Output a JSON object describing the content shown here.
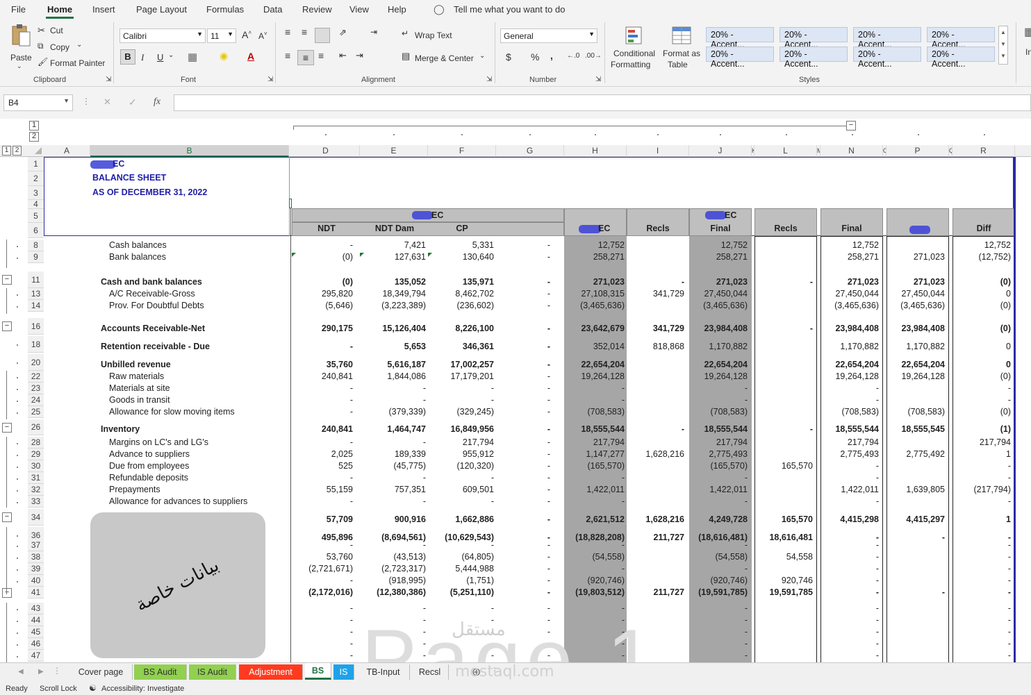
{
  "menu": [
    "File",
    "Home",
    "Insert",
    "Page Layout",
    "Formulas",
    "Data",
    "Review",
    "View",
    "Help"
  ],
  "menu_active": "Home",
  "tell_me": "Tell me what you want to do",
  "clipboard": {
    "paste": "Paste",
    "cut": "Cut",
    "copy": "Copy",
    "format_painter": "Format Painter",
    "label": "Clipboard"
  },
  "font": {
    "name": "Calibri",
    "size": "11",
    "bold": "B",
    "italic": "I",
    "underline": "U",
    "label": "Font"
  },
  "alignment": {
    "wrap": "Wrap Text",
    "merge": "Merge & Center",
    "label": "Alignment"
  },
  "number": {
    "format": "General",
    "currency": "$",
    "percent": "%",
    "comma": ",",
    "label": "Number"
  },
  "styles": {
    "conditional": "Conditional",
    "conditional2": "Formatting",
    "format_as": "Format as",
    "format_as2": "Table",
    "cells": [
      "20% - Accent...",
      "20% - Accent...",
      "20% - Accent...",
      "20% - Accent...",
      "20% - Accent...",
      "20% - Accent...",
      "20% - Accent...",
      "20% - Accent..."
    ],
    "label": "Styles",
    "insert_label": "In"
  },
  "formula_bar": {
    "name_box": "B4",
    "fx": "fx",
    "cancel": "✕",
    "enter": "✓",
    "value": ""
  },
  "outline_levels": [
    "1",
    "2"
  ],
  "columns": [
    "A",
    "B",
    "D",
    "E",
    "F",
    "G",
    "H",
    "I",
    "J",
    "K",
    "L",
    "M",
    "N",
    "O",
    "P",
    "Q",
    "R"
  ],
  "rows": [
    "1",
    "2",
    "3",
    "4",
    "5",
    "6",
    "8",
    "9",
    "11",
    "13",
    "14",
    "16",
    "18",
    "20",
    "22",
    "23",
    "24",
    "25",
    "26",
    "28",
    "29",
    "30",
    "31",
    "32",
    "33",
    "34",
    "36",
    "37",
    "38",
    "39",
    "40",
    "41",
    "43",
    "44",
    "45",
    "46",
    "47"
  ],
  "titles": {
    "company": "EC",
    "report": "BALANCE SHEET",
    "as_of": "AS OF DECEMBER 31, 2022"
  },
  "headers": {
    "group_ec": "EC",
    "ndt": "NDT",
    "ndt_dam": "NDT Dam",
    "cp": "CP",
    "h": "EC",
    "recls": "Recls",
    "j_top": "EC",
    "j_bottom": "Final",
    "l": "Recls",
    "n": "Final",
    "p": "",
    "diff": "Diff"
  },
  "lines": [
    {
      "label": "Cash balances",
      "bold": false,
      "indent": 2,
      "d": "-",
      "e": "7,421",
      "f": "5,331",
      "g": "-",
      "h": "12,752",
      "i": "",
      "j": "12,752",
      "l": "",
      "n": "12,752",
      "p": "",
      "r": "12,752"
    },
    {
      "label": "Bank balances",
      "bold": false,
      "indent": 2,
      "d": "(0)",
      "e": "127,631",
      "f": "130,640",
      "g": "-",
      "h": "258,271",
      "i": "",
      "j": "258,271",
      "l": "",
      "n": "258,271",
      "p": "271,023",
      "r": "(12,752)"
    },
    {
      "label": "Cash and bank balances",
      "bold": true,
      "indent": 1,
      "d": "(0)",
      "e": "135,052",
      "f": "135,971",
      "g": "-",
      "h": "271,023",
      "i": "-",
      "j": "271,023",
      "l": "-",
      "n": "271,023",
      "p": "271,023",
      "r": "(0)"
    },
    {
      "label": "A/C Receivable-Gross",
      "bold": false,
      "indent": 2,
      "d": "295,820",
      "e": "18,349,794",
      "f": "8,462,702",
      "g": "-",
      "h": "27,108,315",
      "i": "341,729",
      "j": "27,450,044",
      "l": "",
      "n": "27,450,044",
      "p": "27,450,044",
      "r": "0"
    },
    {
      "label": "Prov. For Doubtful Debts",
      "bold": false,
      "indent": 2,
      "d": "(5,646)",
      "e": "(3,223,389)",
      "f": "(236,602)",
      "g": "-",
      "h": "(3,465,636)",
      "i": "",
      "j": "(3,465,636)",
      "l": "",
      "n": "(3,465,636)",
      "p": "(3,465,636)",
      "r": "(0)"
    },
    {
      "label": "Accounts Receivable-Net",
      "bold": true,
      "indent": 1,
      "d": "290,175",
      "e": "15,126,404",
      "f": "8,226,100",
      "g": "-",
      "h": "23,642,679",
      "i": "341,729",
      "j": "23,984,408",
      "l": "-",
      "n": "23,984,408",
      "p": "23,984,408",
      "r": "(0)"
    },
    {
      "label": "Retention receivable - Due",
      "bold": true,
      "indent": 1,
      "d": "-",
      "e": "5,653",
      "f": "346,361",
      "g": "-",
      "h": "352,014",
      "i": "818,868",
      "j": "1,170,882",
      "l": "",
      "n": "1,170,882",
      "p": "1,170,882",
      "r": "0",
      "nb": true
    },
    {
      "label": "Unbilled revenue",
      "bold": true,
      "indent": 1,
      "d": "35,760",
      "e": "5,616,187",
      "f": "17,002,257",
      "g": "-",
      "h": "22,654,204",
      "i": "",
      "j": "22,654,204",
      "l": "",
      "n": "22,654,204",
      "p": "22,654,204",
      "r": "0"
    },
    {
      "label": "Raw materials",
      "bold": false,
      "indent": 2,
      "d": "240,841",
      "e": "1,844,086",
      "f": "17,179,201",
      "g": "-",
      "h": "19,264,128",
      "i": "",
      "j": "19,264,128",
      "l": "",
      "n": "19,264,128",
      "p": "19,264,128",
      "r": "(0)"
    },
    {
      "label": "Materials at site",
      "bold": false,
      "indent": 2,
      "d": "-",
      "e": "-",
      "f": "-",
      "g": "-",
      "h": "-",
      "i": "",
      "j": "-",
      "l": "",
      "n": "-",
      "p": "",
      "r": "-"
    },
    {
      "label": "Goods in transit",
      "bold": false,
      "indent": 2,
      "d": "-",
      "e": "-",
      "f": "-",
      "g": "-",
      "h": "-",
      "i": "",
      "j": "-",
      "l": "",
      "n": "-",
      "p": "",
      "r": "-"
    },
    {
      "label": "Allowance for slow moving items",
      "bold": false,
      "indent": 2,
      "d": "-",
      "e": "(379,339)",
      "f": "(329,245)",
      "g": "-",
      "h": "(708,583)",
      "i": "",
      "j": "(708,583)",
      "l": "",
      "n": "(708,583)",
      "p": "(708,583)",
      "r": "(0)"
    },
    {
      "label": "Inventory",
      "bold": true,
      "indent": 1,
      "d": "240,841",
      "e": "1,464,747",
      "f": "16,849,956",
      "g": "-",
      "h": "18,555,544",
      "i": "-",
      "j": "18,555,544",
      "l": "-",
      "n": "18,555,544",
      "p": "18,555,545",
      "r": "(1)"
    },
    {
      "label": "Margins on LC's and LG's",
      "bold": false,
      "indent": 2,
      "d": "-",
      "e": "-",
      "f": "217,794",
      "g": "-",
      "h": "217,794",
      "i": "",
      "j": "217,794",
      "l": "",
      "n": "217,794",
      "p": "",
      "r": "217,794"
    },
    {
      "label": "Advance to suppliers",
      "bold": false,
      "indent": 2,
      "d": "2,025",
      "e": "189,339",
      "f": "955,912",
      "g": "-",
      "h": "1,147,277",
      "i": "1,628,216",
      "j": "2,775,493",
      "l": "",
      "n": "2,775,493",
      "p": "2,775,492",
      "r": "1"
    },
    {
      "label": "Due from employees",
      "bold": false,
      "indent": 2,
      "d": "525",
      "e": "(45,775)",
      "f": "(120,320)",
      "g": "-",
      "h": "(165,570)",
      "i": "",
      "j": "(165,570)",
      "l": "165,570",
      "n": "-",
      "p": "",
      "r": "-"
    },
    {
      "label": "Refundable deposits",
      "bold": false,
      "indent": 2,
      "d": "-",
      "e": "-",
      "f": "-",
      "g": "-",
      "h": "-",
      "i": "",
      "j": "-",
      "l": "",
      "n": "-",
      "p": "",
      "r": "-"
    },
    {
      "label": "Prepayments",
      "bold": false,
      "indent": 2,
      "d": "55,159",
      "e": "757,351",
      "f": "609,501",
      "g": "-",
      "h": "1,422,011",
      "i": "",
      "j": "1,422,011",
      "l": "",
      "n": "1,422,011",
      "p": "1,639,805",
      "r": "(217,794)"
    },
    {
      "label": "Allowance for advances to suppliers",
      "bold": false,
      "indent": 2,
      "d": "-",
      "e": "-",
      "f": "-",
      "g": "-",
      "h": "-",
      "i": "",
      "j": "-",
      "l": "",
      "n": "-",
      "p": "",
      "r": "-"
    },
    {
      "label": "",
      "bold": true,
      "indent": 1,
      "d": "57,709",
      "e": "900,916",
      "f": "1,662,886",
      "g": "-",
      "h": "2,621,512",
      "i": "1,628,216",
      "j": "4,249,728",
      "l": "165,570",
      "n": "4,415,298",
      "p": "4,415,297",
      "r": "1"
    },
    {
      "label": "",
      "bold": true,
      "indent": 1,
      "d": "495,896",
      "e": "(8,694,561)",
      "f": "(10,629,543)",
      "g": "-",
      "h": "(18,828,208)",
      "i": "211,727",
      "j": "(18,616,481)",
      "l": "18,616,481",
      "n": "-",
      "p": "-",
      "r": "-"
    },
    {
      "label": "",
      "bold": false,
      "indent": 2,
      "d": "-",
      "e": "-",
      "f": "-",
      "g": "-",
      "h": "-",
      "i": "",
      "j": "-",
      "l": "",
      "n": "-",
      "p": "",
      "r": "-"
    },
    {
      "label": "",
      "bold": false,
      "indent": 2,
      "d": "53,760",
      "e": "(43,513)",
      "f": "(64,805)",
      "g": "-",
      "h": "(54,558)",
      "i": "",
      "j": "(54,558)",
      "l": "54,558",
      "n": "-",
      "p": "",
      "r": "-"
    },
    {
      "label": "",
      "bold": false,
      "indent": 2,
      "d": "(2,721,671)",
      "e": "(2,723,317)",
      "f": "5,444,988",
      "g": "-",
      "h": "-",
      "i": "",
      "j": "-",
      "l": "",
      "n": "-",
      "p": "",
      "r": "-"
    },
    {
      "label": "",
      "bold": false,
      "indent": 2,
      "d": "-",
      "e": "(918,995)",
      "f": "(1,751)",
      "g": "-",
      "h": "(920,746)",
      "i": "",
      "j": "(920,746)",
      "l": "920,746",
      "n": "-",
      "p": "",
      "r": "-"
    },
    {
      "label": "",
      "bold": true,
      "indent": 1,
      "d": "(2,172,016)",
      "e": "(12,380,386)",
      "f": "(5,251,110)",
      "g": "-",
      "h": "(19,803,512)",
      "i": "211,727",
      "j": "(19,591,785)",
      "l": "19,591,785",
      "n": "-",
      "p": "-",
      "r": "-"
    },
    {
      "label": "",
      "bold": false,
      "indent": 2,
      "d": "-",
      "e": "-",
      "f": "-",
      "g": "-",
      "h": "-",
      "i": "",
      "j": "-",
      "l": "",
      "n": "-",
      "p": "",
      "r": "-"
    },
    {
      "label": "",
      "bold": false,
      "indent": 2,
      "d": "-",
      "e": "-",
      "f": "-",
      "g": "-",
      "h": "-",
      "i": "",
      "j": "-",
      "l": "",
      "n": "-",
      "p": "",
      "r": "-"
    },
    {
      "label": "",
      "bold": false,
      "indent": 2,
      "d": "-",
      "e": "-",
      "f": "-",
      "g": "-",
      "h": "-",
      "i": "",
      "j": "-",
      "l": "",
      "n": "-",
      "p": "",
      "r": "-"
    },
    {
      "label": "",
      "bold": false,
      "indent": 2,
      "d": "-",
      "e": "-",
      "f": "-",
      "g": "-",
      "h": "-",
      "i": "",
      "j": "-",
      "l": "",
      "n": "-",
      "p": "",
      "r": "-"
    },
    {
      "label": "",
      "bold": false,
      "indent": 2,
      "d": "-",
      "e": "-",
      "f": "-",
      "g": "-",
      "h": "-",
      "i": "",
      "j": "-",
      "l": "",
      "n": "-",
      "p": "",
      "r": "-"
    }
  ],
  "privacy_label": "بيانات خاصة",
  "watermark": {
    "page": "Page 1",
    "brand": "مستقل",
    "url": "mostaql.com"
  },
  "tabs": [
    {
      "label": "Cover page",
      "color": "#f0f0f0"
    },
    {
      "label": "BS Audit",
      "color": "#92d050"
    },
    {
      "label": "IS Audit",
      "color": "#92d050"
    },
    {
      "label": "Adjustment",
      "color": "#ff3b1f"
    },
    {
      "label": "BS",
      "color": "#ffffff"
    },
    {
      "label": "IS",
      "color": "#1fa2e8"
    },
    {
      "label": "TB-Input",
      "color": "#f0f0f0"
    },
    {
      "label": "Recsl",
      "color": "#f0f0f0"
    }
  ],
  "status": {
    "ready": "Ready",
    "scroll_lock": "Scroll Lock",
    "accessibility": "Accessibility: Investigate"
  },
  "colors": {
    "ribbon": "#f3f3f3",
    "accent": "#217346",
    "title_blue": "#1f1fa8",
    "shade": "#a6a6a6",
    "header_grey": "#bfbfbf"
  }
}
